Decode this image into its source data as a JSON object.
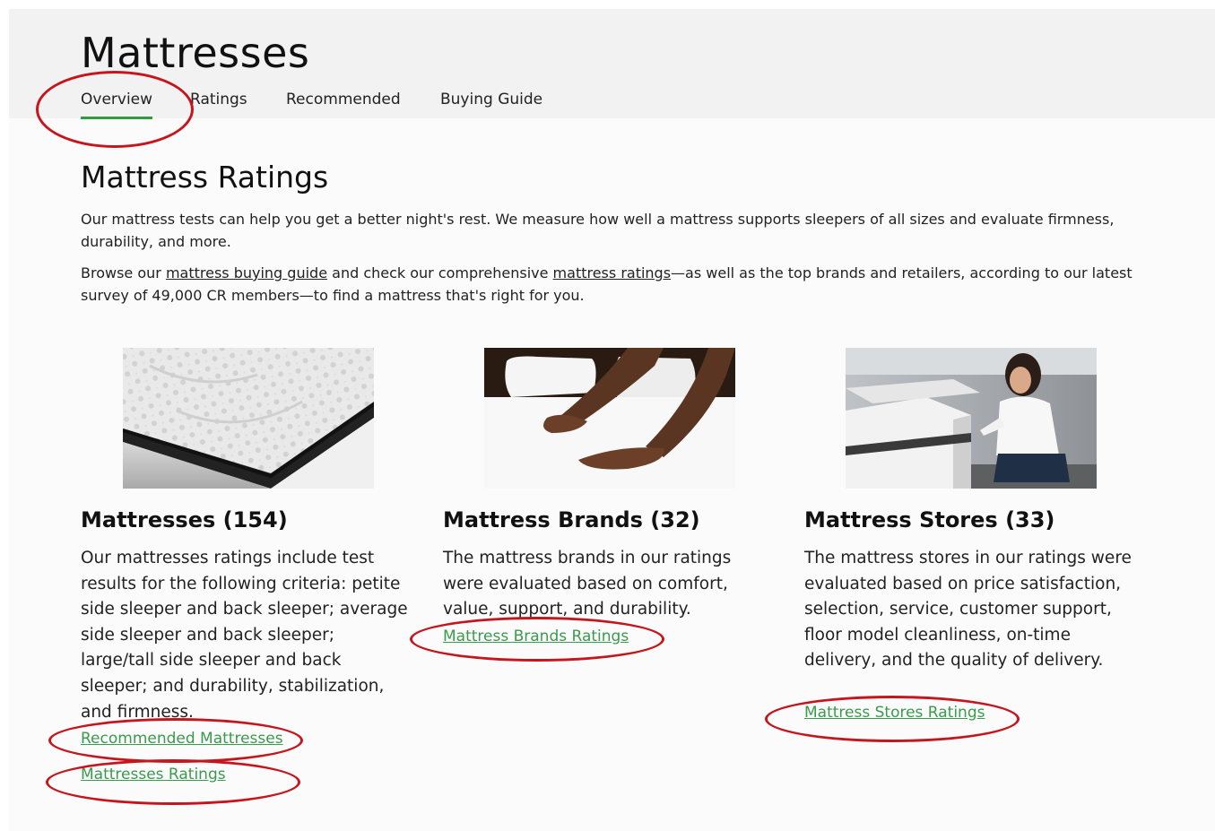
{
  "header": {
    "title": "Mattresses",
    "tabs": [
      {
        "label": "Overview",
        "active": true
      },
      {
        "label": "Ratings",
        "active": false
      },
      {
        "label": "Recommended",
        "active": false
      },
      {
        "label": "Buying Guide",
        "active": false
      }
    ]
  },
  "intro": {
    "title": "Mattress Ratings",
    "paragraph1": "Our mattress tests can help you get a better night's rest. We measure how well a mattress supports sleepers of all sizes and evaluate firmness, durability, and more.",
    "p2_text1": "Browse our ",
    "p2_link1": "mattress buying guide",
    "p2_text2": " and check our comprehensive ",
    "p2_link2": "mattress ratings",
    "p2_text3": "—as well as the top brands and retailers, according to our latest survey of 49,000 CR members—to find a mattress that's right for you."
  },
  "cards": [
    {
      "heading": "Mattresses (154)",
      "description": "Our mattresses ratings include test results for the following criteria: petite side sleeper and back sleeper; average side sleeper and back sleeper; large/tall side sleeper and back sleeper; and durability, stabilization, and firmness.",
      "links": [
        "Recommended Mattresses",
        "Mattresses Ratings"
      ]
    },
    {
      "heading": "Mattress Brands (32)",
      "description": "The mattress brands in our ratings were evaluated based on comfort, value, support, and durability.",
      "links": [
        "Mattress Brands Ratings"
      ]
    },
    {
      "heading": "Mattress Stores (33)",
      "description": "The mattress stores in our ratings were evaluated based on price satisfaction, selection, service, customer support, floor model cleanliness, on-time delivery, and the quality of delivery.",
      "links": [
        "Mattress Stores Ratings"
      ]
    }
  ],
  "colors": {
    "accent_green": "#2e9c3a",
    "link_green": "#3a9a4d",
    "annotation_red": "#c4161c"
  }
}
